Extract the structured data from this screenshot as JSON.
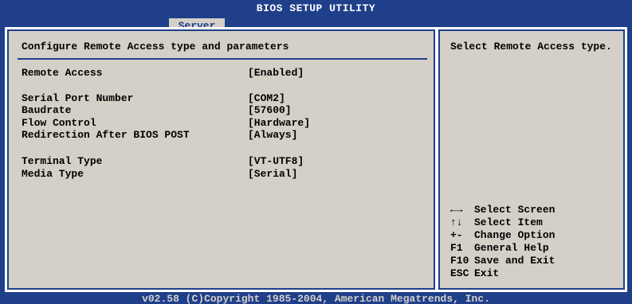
{
  "header": {
    "title": "BIOS SETUP UTILITY",
    "active_tab": "Server"
  },
  "main": {
    "section_title": "Configure Remote Access type and parameters",
    "settings": [
      {
        "label": "Remote Access",
        "value": "[Enabled]"
      },
      {
        "label": "Serial Port Number",
        "value": "[COM2]"
      },
      {
        "label": "Baudrate",
        "value": "[57600]"
      },
      {
        "label": "Flow Control",
        "value": "[Hardware]"
      },
      {
        "label": "Redirection After BIOS POST",
        "value": "[Always]"
      },
      {
        "label": "Terminal Type",
        "value": "[VT-UTF8]"
      },
      {
        "label": "Media Type",
        "value": "[Serial]"
      }
    ]
  },
  "help": {
    "text": "Select Remote Access type.",
    "legend": [
      {
        "key": "←→",
        "action": "Select Screen"
      },
      {
        "key": "↑↓",
        "action": "Select Item"
      },
      {
        "key": "+-",
        "action": "Change Option"
      },
      {
        "key": "F1",
        "action": "General Help"
      },
      {
        "key": "F10",
        "action": "Save and Exit"
      },
      {
        "key": "ESC",
        "action": "Exit"
      }
    ]
  },
  "footer": {
    "copyright": "v02.58 (C)Copyright 1985-2004, American Megatrends, Inc."
  },
  "colors": {
    "background_blue": "#1f3f8a",
    "panel_gray": "#d4d0c8",
    "border_white": "#ffffff",
    "text_black": "#000000"
  }
}
